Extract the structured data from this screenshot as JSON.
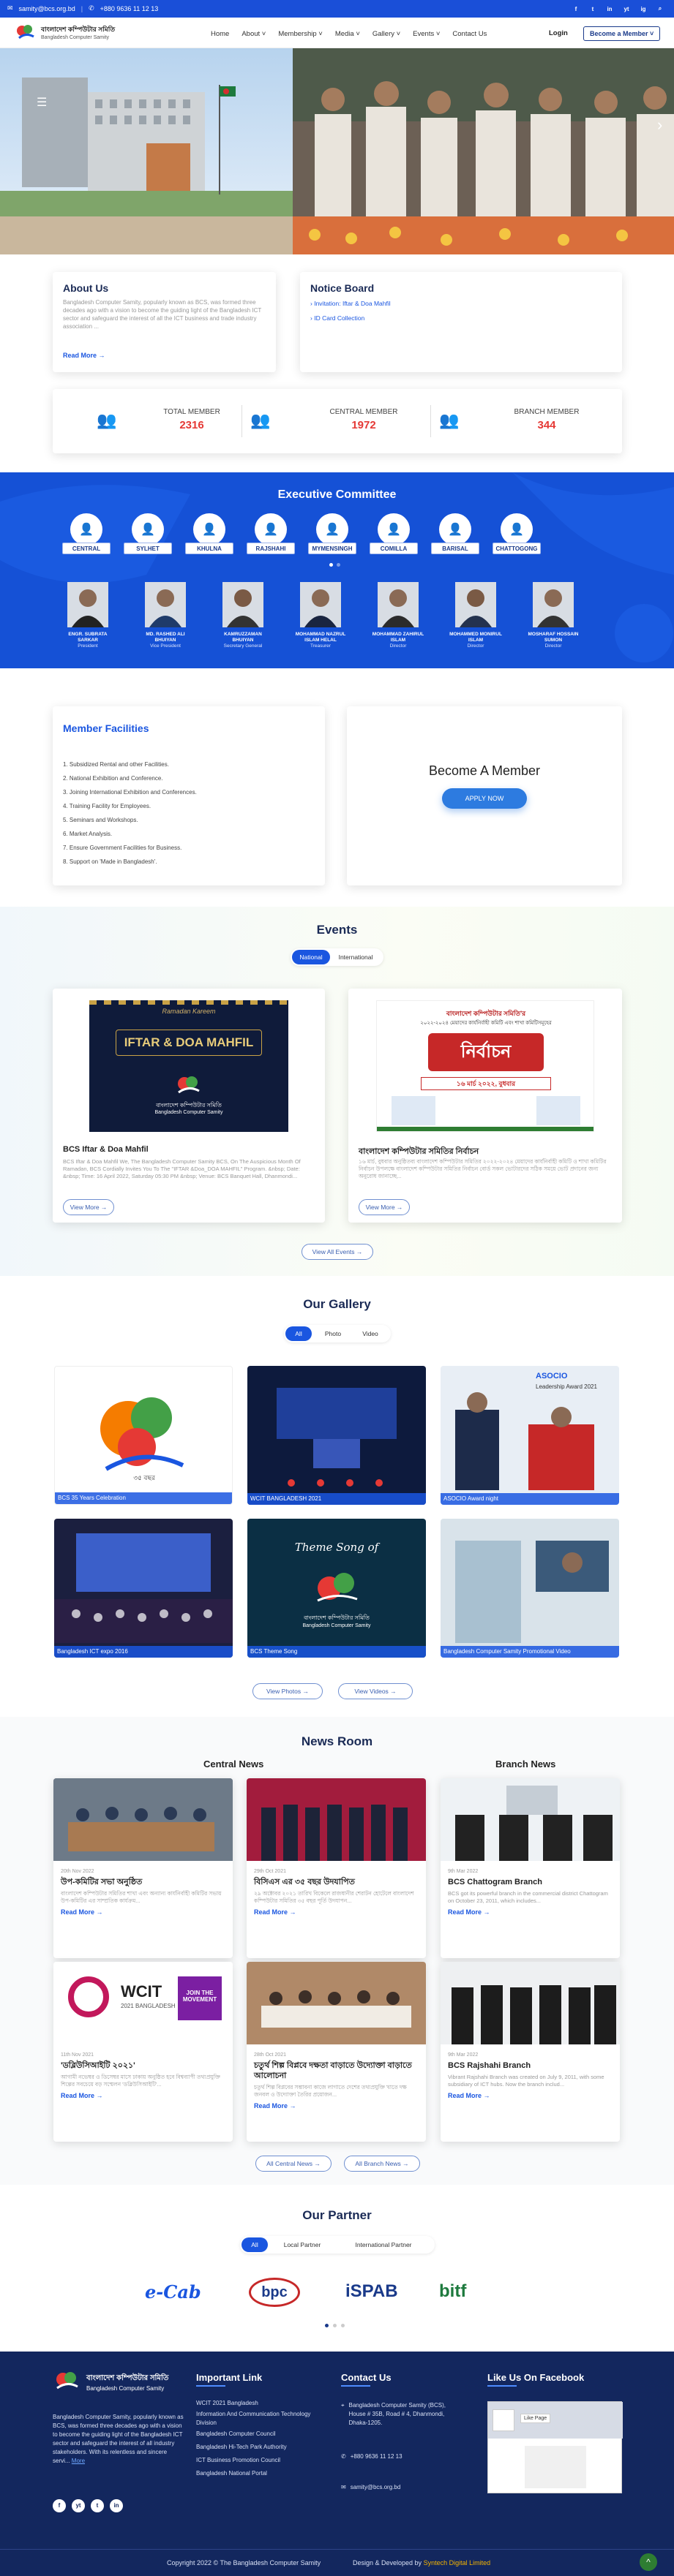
{
  "topbar": {
    "email": "samity@bcs.org.bd",
    "phone": "+880 9636 11 12 13",
    "socials": [
      "f",
      "t",
      "in",
      "yt",
      "ig"
    ]
  },
  "brand": {
    "bn": "বাংলাদেশ কম্পিউটার সমিতি",
    "en": "Bangladesh Computer Samity"
  },
  "nav": {
    "items": [
      "Home",
      "About ˅",
      "Membership ˅",
      "Media ˅",
      "Gallery ˅",
      "Events ˅",
      "Contact Us"
    ],
    "login": "Login",
    "become": "Become a Member ˅"
  },
  "about": {
    "title": "About Us",
    "text": "Bangladesh Computer Samity, popularly known as BCS, was formed three decades ago with a vision to become the guiding light of the Bangladesh ICT sector and safeguard the interest of all the ICT business and trade industry association ...",
    "link": "Read More →"
  },
  "notice": {
    "title": "Notice Board",
    "items": [
      "Invitation: Iftar & Doa Mahfil",
      "ID Card Collection"
    ]
  },
  "stats": [
    {
      "label": "TOTAL MEMBER",
      "value": "2316"
    },
    {
      "label": "CENTRAL MEMBER",
      "value": "1972"
    },
    {
      "label": "BRANCH MEMBER",
      "value": "344"
    }
  ],
  "ec": {
    "title": "Executive Committee",
    "regions": [
      "CENTRAL",
      "SYLHET",
      "KHULNA",
      "RAJSHAHI",
      "MYMENSINGH",
      "COMILLA",
      "BARISAL",
      "CHATTOGONG"
    ],
    "members": [
      {
        "name": "ENGR. SUBRATA SARKAR",
        "role": "President"
      },
      {
        "name": "MD. RASHED ALI BHUIYAN",
        "role": "Vice President"
      },
      {
        "name": "KAMRUZZAMAN BHUIYAN",
        "role": "Secretary General"
      },
      {
        "name": "MOHAMMAD NAZRUL ISLAM HELAL",
        "role": "Treasurer"
      },
      {
        "name": "MOHAMMAD ZAHIRUL ISLAM",
        "role": "Director"
      },
      {
        "name": "MOHAMMED MONIRUL ISLAM",
        "role": "Director"
      },
      {
        "name": "MOSHARAF HOSSAIN SUMON",
        "role": "Director"
      }
    ]
  },
  "facilities": {
    "title": "Member Facilities",
    "items": [
      "1. Subsidized Rental and other Facilities.",
      "2. National Exhibition and Conference.",
      "3. Joining International Exhibition and Conferences.",
      "4. Training Facility for Employees.",
      "5. Seminars and Workshops.",
      "6. Market Analysis.",
      "7. Ensure Government Facilities for Business.",
      "8. Support on 'Made in Bangladesh'."
    ]
  },
  "become": {
    "title": "Become A Member",
    "button": "APPLY NOW"
  },
  "events": {
    "title": "Events",
    "tabs": [
      "National",
      "International"
    ],
    "items": [
      {
        "title": "BCS Iftar & Doa Mahfil",
        "text": "BCS Iftar & Doa Mahfil We, The Bangladesh Computer Samity BCS, On The Auspicious Month Of Ramadan, BCS Cordially Invites You To The \"IFTAR &Doa_DOA MAHFIL\" Program. &nbsp; Date: &nbsp; Time: 16 April 2022, Saturday 05:30 PM &nbsp; Venue: BCS Banquet Hall, Dhanmondi...",
        "button": "View More →",
        "banner_script": "Ramadan Kareem",
        "banner_title": "IFTAR & DOA MAHFIL"
      },
      {
        "title": "বাংলাদেশ কম্পিউটার সমিতির নির্বাচন",
        "text": "১৬ মার্চ, বুধবার অনুষ্ঠিতব্য বাংলাদেশ কম্পিউটার সমিতির ২০২২-২০২৪ মেয়াদের কার্যনির্বাহী কমিটি ও শাখা কমিটির নির্বাচন উপলক্ষে বাংলাদেশ কম্পিউটার সমিতির নির্বাচন বোর্ড সকল ভোটারদের সঠিক সময়ে ভোট প্রদানের জন্য অনুরোধ জানাচ্ছে...",
        "button": "View More →",
        "banner_l1": "বাংলাদেশ কম্পিউটার সমিতি'র",
        "banner_l2": "২০২২-২০২৪ মেয়াদের কার্যনির্বাহী কমিটি এবং শাখা কমিটিসমূহের",
        "banner_big": "নির্বাচন",
        "banner_date": "১৬ মার্চ ২০২২, বুধবার"
      }
    ],
    "all": "View All Events →"
  },
  "gallery": {
    "title": "Our Gallery",
    "tabs": [
      "All",
      "Photo",
      "Video"
    ],
    "items": [
      "BCS 35 Years Celebration",
      "WCIT BANGLADESH 2021",
      "ASOCIO Award night",
      "Bangladesh ICT expo 2016",
      "BCS Theme Song",
      "Bangladesh Computer Samity Promotional Video"
    ],
    "txt_35": "৩৫ বছর",
    "txt_asocio": "ASOCIO",
    "txt_award": "Leadership Award 2021",
    "txt_theme": "Theme Song of",
    "photos": "View Photos →",
    "videos": "View Videos →"
  },
  "news": {
    "title": "News Room",
    "central": "Central News",
    "branch": "Branch News",
    "items": [
      {
        "date": "20th Nov 2022",
        "title": "উপ-কমিটির সভা অনুষ্ঠিত",
        "text": "বাংলাদেশ কম্পিউটার সমিতির শাখা এবং অন্যান্য কার্যনির্বাহী কমিটির সভায় উপ-কমিটির এর সাম্প্রতিক কার্যক্রম..."
      },
      {
        "date": "29th Oct 2021",
        "title": "বিসিএস এর ৩৫ বছর উদযাপিত",
        "text": "২৯ অক্টোবর ২০২১ তারিখ বিকেলে রাজধানীর শেরাটন হোটেলে বাংলাদেশ কম্পিউটার সমিতির ৩৫ বছর পূর্তি উদযাপন..."
      },
      {
        "date": "9th Mar 2022",
        "title": "BCS Chattogram Branch",
        "text": "BCS got its powerful branch in the commercial district Chattogram on October 23, 2011, which includes..."
      },
      {
        "date": "11th Nov 2021",
        "title": "'ডব্লিউসিআইটি ২০২১'",
        "text": "আগামী নভেম্বর ও ডিসেম্বর মাসে ঢাকায় অনুষ্ঠিত হবে বিশ্বব্যাপী তথ্যপ্রযুক্তি শিল্পের সবচেয়ে বড় সম্মেলন 'ডব্লিউসিআইটি'..."
      },
      {
        "date": "28th Oct 2021",
        "title": "চতুর্থ শিল্প বিপ্লবে দক্ষতা বাড়াতে উদ্যোক্তা বাড়াতে আলোচনা",
        "text": "চতুর্থ শিল্প বিপ্লবের সম্ভাবনা কাজে লাগাতে দেশের তথ্যপ্রযুক্তি খাতে দক্ষ জনবল ও উদ্যোক্তা তৈরির প্রয়োজন..."
      },
      {
        "date": "9th Mar 2022",
        "title": "BCS Rajshahi Branch",
        "text": "Vibrant Rajshahi Branch was created on July 9, 2011, with some subsidiary of ICT hubs. Now the branch includ..."
      }
    ],
    "readmore": "Read More →",
    "central_btn": "All Central News →",
    "branch_btn": "All Branch News →",
    "wcit": "WCIT",
    "wcit_sub": "2021 BANGLADESH",
    "wcit_move": "JOIN THE MOVEMENT"
  },
  "partner": {
    "title": "Our Partner",
    "tabs": [
      "All",
      "Local Partner",
      "International Partner"
    ],
    "logos": [
      "e-Cab",
      "bpc",
      "iSPAB",
      "bitf"
    ]
  },
  "footer": {
    "about": "Bangladesh Computer Samity, popularly known as BCS, was formed three decades ago with a vision to become the guiding light of the Bangladesh ICT sector and safeguard the interest of all industry stakeholders. With its relentless and sincere servi...",
    "more": "More",
    "important_title": "Important Link",
    "links": [
      "WCIT 2021 Bangladesh",
      "Information And Communication Technology Division",
      "Bangladesh Computer Council",
      "Bangladesh Hi-Tech Park Authority",
      "ICT Business Promotion Council",
      "Bangladesh National Portal"
    ],
    "contact_title": "Contact Us",
    "address": "Bangladesh Computer Samity (BCS), House # 35B, Road # 4, Dhanmondi, Dhaka-1205.",
    "phone": "+880 9636 11 12 13",
    "email": "samity@bcs.org.bd",
    "fb_title": "Like Us On Facebook",
    "fb_like": "Like Page",
    "copyright": "Copyright 2022 © The Bangladesh Computer Samity",
    "dev_by": "Design & Developed by",
    "dev": "Syntech Digital Limited"
  }
}
